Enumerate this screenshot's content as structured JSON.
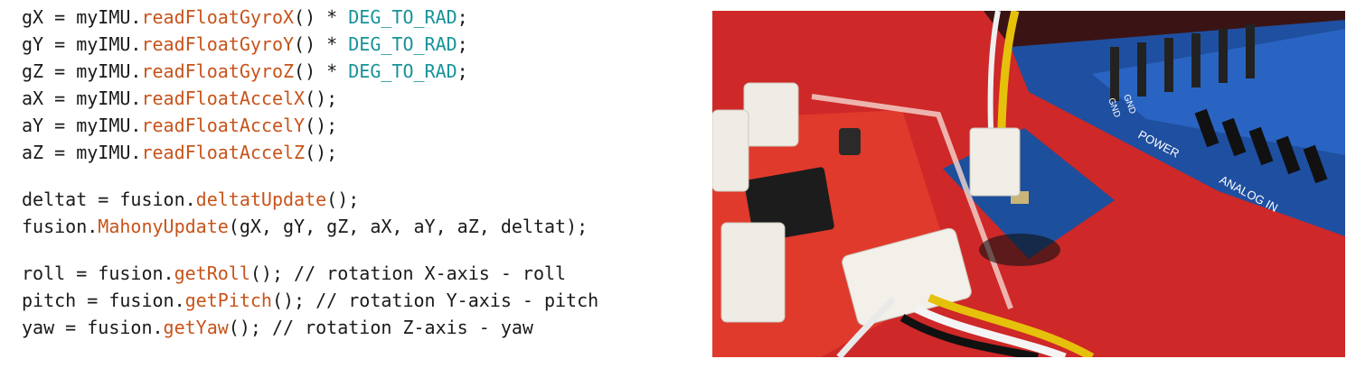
{
  "code_lines": [
    {
      "segs": [
        "gX = myIMU.",
        "readFloatGyroX",
        "() * ",
        "DEG_TO_RAD",
        ";"
      ]
    },
    {
      "segs": [
        "gY = myIMU.",
        "readFloatGyroY",
        "() * ",
        "DEG_TO_RAD",
        ";"
      ]
    },
    {
      "segs": [
        "gZ = myIMU.",
        "readFloatGyroZ",
        "() * ",
        "DEG_TO_RAD",
        ";"
      ]
    },
    {
      "segs": [
        "aX = myIMU.",
        "readFloatAccelX",
        "();"
      ]
    },
    {
      "segs": [
        "aY = myIMU.",
        "readFloatAccelY",
        "();"
      ]
    },
    {
      "segs": [
        "aZ = myIMU.",
        "readFloatAccelZ",
        "();"
      ]
    },
    {
      "segs": [
        "deltat = fusion.",
        "deltatUpdate",
        "();"
      ]
    },
    {
      "segs": [
        "fusion.",
        "MahonyUpdate",
        "(gX, gY, gZ, aX, aY, aZ, deltat);"
      ]
    },
    {
      "segs": [
        "roll = fusion.",
        "getRoll",
        "(); // rotation X-axis - roll"
      ]
    },
    {
      "segs": [
        "pitch = fusion.",
        "getPitch",
        "(); // rotation Y-axis - pitch"
      ]
    },
    {
      "segs": [
        "yaw = fusion.",
        "getYaw",
        "(); // rotation Z-axis - yaw"
      ]
    }
  ],
  "photo_labels": {
    "power": "POWER",
    "analog_in": "ANALOG IN",
    "gnd1": "GND",
    "gnd2": "GND"
  },
  "colors": {
    "function": "#c8531a",
    "constant": "#17939a",
    "text": "#1a1a1a",
    "board_red": "#d62b2b",
    "board_blue": "#1f4fa0"
  }
}
